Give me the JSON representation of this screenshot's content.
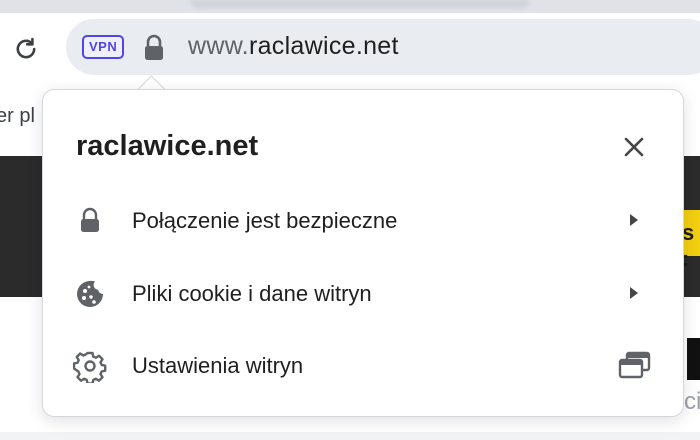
{
  "toolbar": {
    "vpn_label": "VPN",
    "url_prefix": "www.",
    "url_domain": "raclawice.net"
  },
  "bookmarks": {
    "fragment": "er pl"
  },
  "page": {
    "yellow_fragment": "s :",
    "bottom_fragment": "ci"
  },
  "popup": {
    "title": "raclawice.net",
    "items": [
      {
        "label": "Połączenie jest bezpieczne",
        "icon": "lock-icon"
      },
      {
        "label": "Pliki cookie i dane witryn",
        "icon": "cookie-icon"
      },
      {
        "label": "Ustawienia witryn",
        "icon": "gear-icon"
      }
    ]
  },
  "colors": {
    "vpn_accent": "#4f46e5",
    "omnibox_bg": "#e9edf2",
    "icon_gray": "#5f6368"
  }
}
